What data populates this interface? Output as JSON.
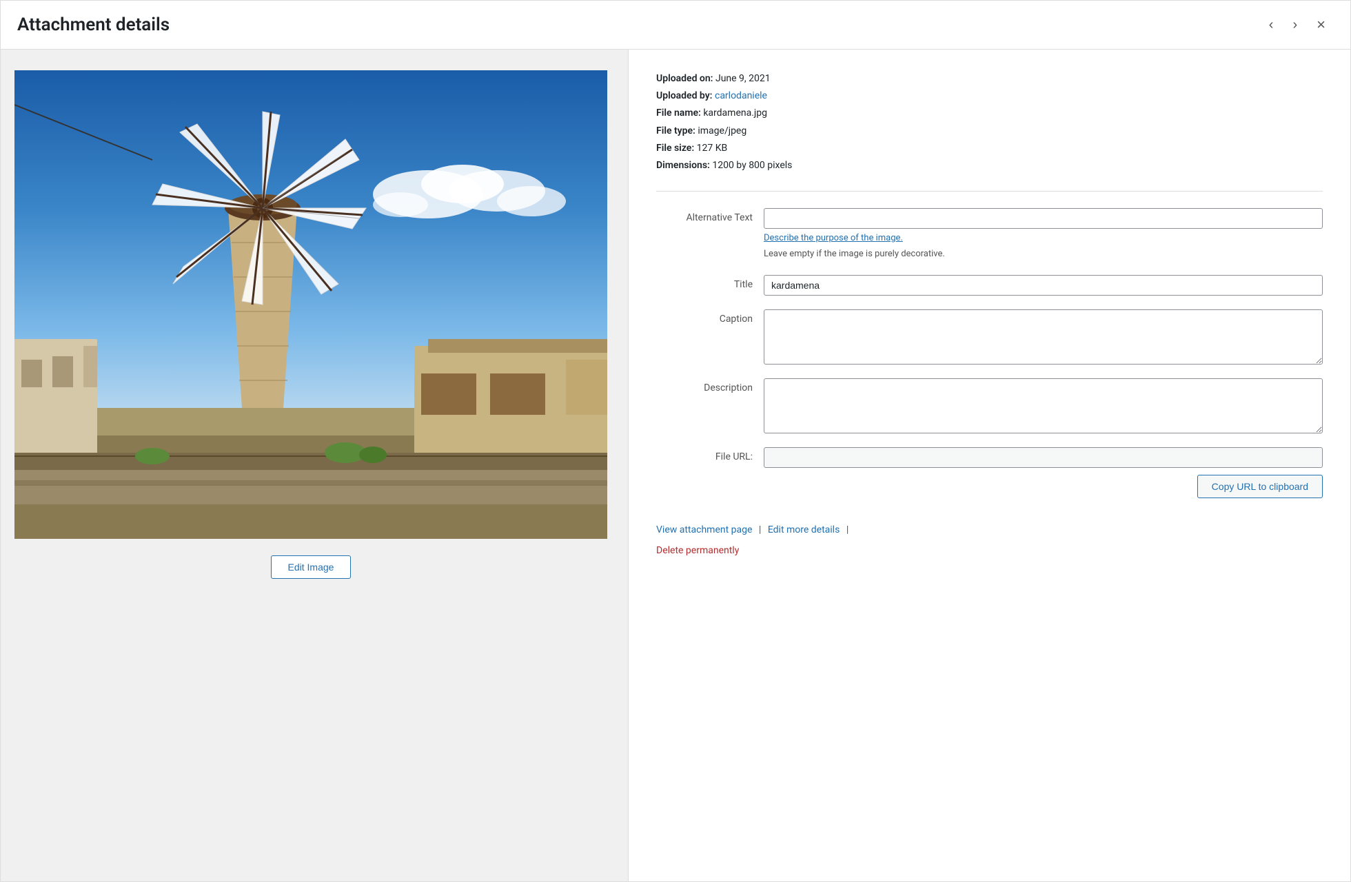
{
  "header": {
    "title": "Attachment details",
    "prev_label": "‹",
    "next_label": "›",
    "close_label": "×"
  },
  "meta": {
    "uploaded_on_label": "Uploaded on:",
    "uploaded_on_value": "June 9, 2021",
    "uploaded_by_label": "Uploaded by:",
    "uploaded_by_value": "carlodaniele",
    "file_name_label": "File name:",
    "file_name_value": "kardamena.jpg",
    "file_type_label": "File type:",
    "file_type_value": "image/jpeg",
    "file_size_label": "File size:",
    "file_size_value": "127 KB",
    "dimensions_label": "Dimensions:",
    "dimensions_value": "1200 by 800 pixels"
  },
  "form": {
    "alt_text_label": "Alternative Text",
    "alt_text_value": "",
    "alt_text_placeholder": "",
    "alt_text_helper_link": "Describe the purpose of the image.",
    "alt_text_helper_text": "Leave empty if the image is purely decorative.",
    "title_label": "Title",
    "title_value": "kardamena",
    "caption_label": "Caption",
    "caption_value": "",
    "description_label": "Description",
    "description_value": "",
    "file_url_label": "File URL:",
    "file_url_value": ""
  },
  "buttons": {
    "edit_image": "Edit Image",
    "copy_url": "Copy URL to clipboard"
  },
  "footer": {
    "view_attachment": "View attachment page",
    "separator1": "|",
    "edit_more": "Edit more details",
    "separator2": "|",
    "delete": "Delete permanently"
  }
}
